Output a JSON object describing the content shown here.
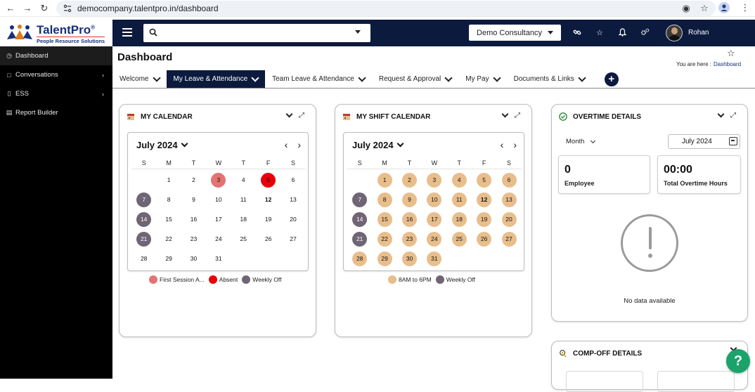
{
  "browser": {
    "url": "democompany.talentpro.in/dashboard"
  },
  "header": {
    "logo_title": "TalentPro",
    "logo_reg": "®",
    "logo_subtitle": "People Resource Solutions",
    "search_value": "",
    "company": "Demo Consultancy",
    "user_name": "Rohan"
  },
  "sidebar": {
    "items": [
      {
        "label": "Dashboard",
        "icon": "dashboard-icon"
      },
      {
        "label": "Conversations",
        "icon": "chat-icon"
      },
      {
        "label": "ESS",
        "icon": "ess-icon"
      },
      {
        "label": "Report Builder",
        "icon": "report-icon"
      }
    ]
  },
  "page": {
    "title": "Dashboard",
    "breadcrumb_label": "You are here :",
    "breadcrumb_value": "Dashboard"
  },
  "tabs": [
    {
      "label": "Welcome",
      "active": false
    },
    {
      "label": "My Leave & Attendance",
      "active": true
    },
    {
      "label": "Team Leave & Attendance",
      "active": false
    },
    {
      "label": "Request & Approval",
      "active": false
    },
    {
      "label": "My Pay",
      "active": false
    },
    {
      "label": "Documents & Links",
      "active": false
    }
  ],
  "add_tab_label": "+",
  "colors": {
    "navy": "#0c1a3e",
    "first_session": "#e57373",
    "absent": "#e8000b",
    "weekly_off": "#6f6575",
    "shift": "#e8be8c"
  },
  "my_calendar": {
    "title": "MY CALENDAR",
    "month": "July 2024",
    "weekdays": [
      "S",
      "M",
      "T",
      "W",
      "T",
      "F",
      "S"
    ],
    "legend": [
      {
        "label": "First Session A...",
        "color": "#e57373"
      },
      {
        "label": "Absent",
        "color": "#e8000b"
      },
      {
        "label": "Weekly Off",
        "color": "#6f6575"
      }
    ]
  },
  "shift_calendar": {
    "title": "MY SHIFT CALENDAR",
    "month": "July 2024",
    "weekdays": [
      "S",
      "M",
      "T",
      "W",
      "T",
      "F",
      "S"
    ],
    "legend": [
      {
        "label": "8AM to 6PM",
        "color": "#e8be8c"
      },
      {
        "label": "Weekly Off",
        "color": "#6f6575"
      }
    ]
  },
  "overtime": {
    "title": "OVERTIME DETAILS",
    "period": "Month",
    "date": "July 2024",
    "employee_value": "0",
    "employee_label": "Employee",
    "hours_value": "00:00",
    "hours_label": "Total Overtime Hours",
    "no_data": "No data available"
  },
  "compoff": {
    "title": "COMP-OFF DETAILS"
  },
  "help_label": "?"
}
